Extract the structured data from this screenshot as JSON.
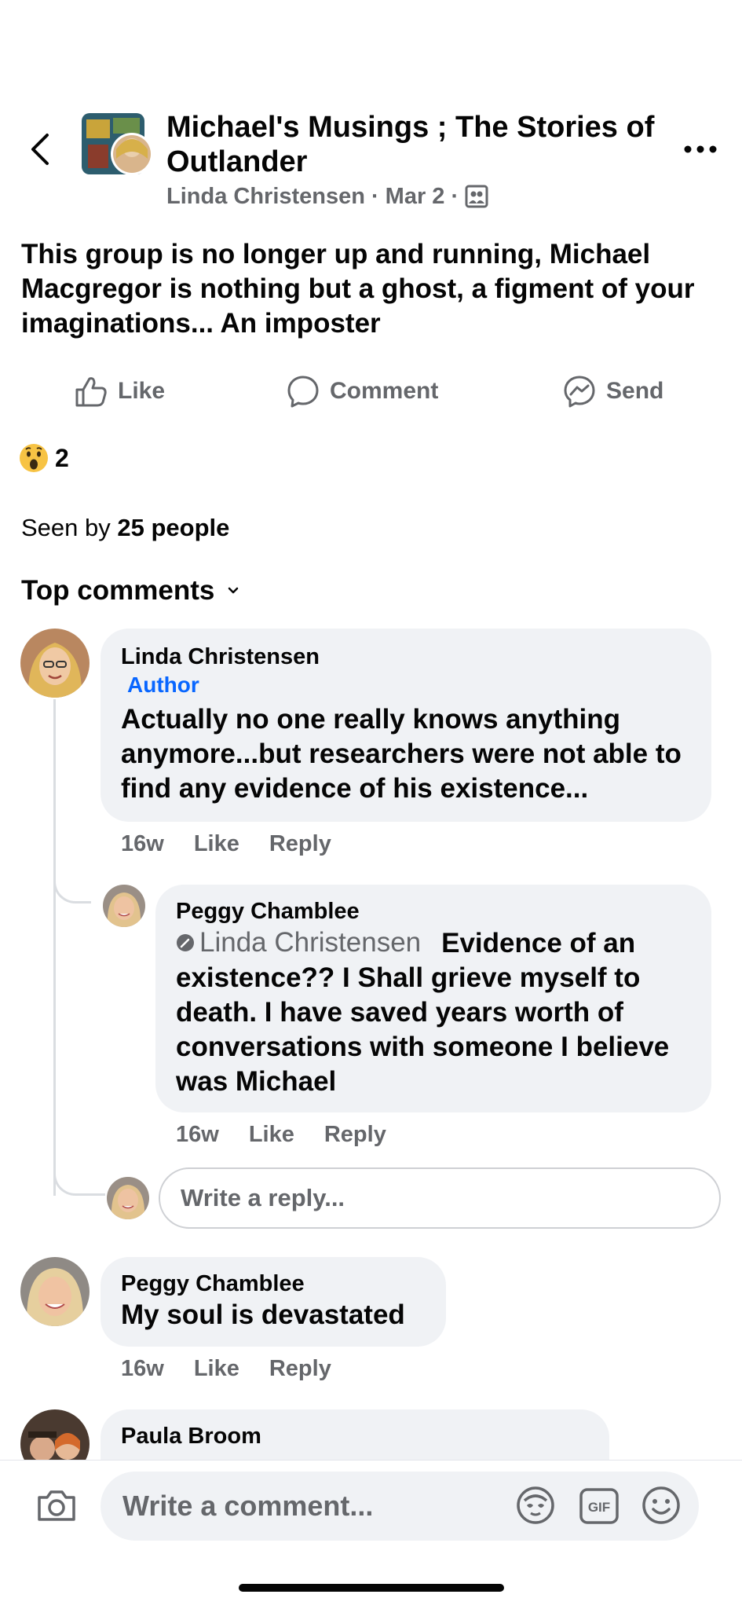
{
  "header": {
    "group_title": "Michael's Musings ; The Stories of Outlander",
    "author": "Linda Christensen",
    "date": "Mar 2",
    "separator": "·",
    "privacy_icon": "members-group-icon"
  },
  "post": {
    "text": "This group is no longer up and running, Michael Macgregor is nothing but a ghost, a figment of your imaginations... An imposter"
  },
  "actions": {
    "like": "Like",
    "comment": "Comment",
    "send": "Send"
  },
  "reactions": {
    "emoji": "wow-reaction",
    "count": "2"
  },
  "seen": {
    "prefix": "Seen by ",
    "count_text": "25 people"
  },
  "top_comments_label": "Top comments",
  "comments": [
    {
      "name": "Linda Christensen",
      "badge": "Author",
      "text": "Actually no one really knows anything anymore...but researchers were not able to find any evidence of his existence...",
      "time": "16w",
      "like": "Like",
      "reply": "Reply"
    },
    {
      "name": "Peggy Chamblee",
      "mention": "Linda Christensen",
      "text": "Evidence of an existence??  I Shall grieve  myself  to death.  I have saved years worth of conversations with someone  I believe was Michael",
      "time": "16w",
      "like": "Like",
      "reply": "Reply"
    },
    {
      "name": "Peggy Chamblee",
      "text": "My soul is devastated",
      "time": "16w",
      "like": "Like",
      "reply": "Reply"
    },
    {
      "name": "Paula Broom"
    }
  ],
  "reply_placeholder": "Write a reply...",
  "comment_placeholder": "Write a comment...",
  "colors": {
    "accent": "#0866ff",
    "bubble": "#f0f2f5",
    "secondary_text": "#65676b"
  }
}
